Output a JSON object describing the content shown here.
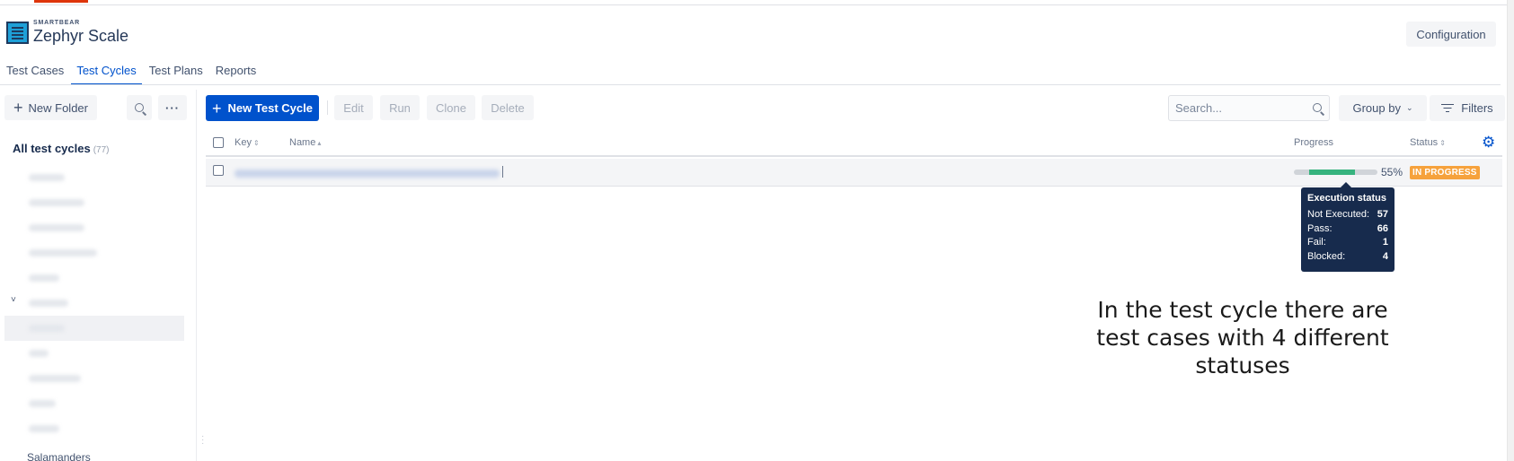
{
  "brand": {
    "vendor": "SMARTBEAR",
    "product": "Zephyr Scale"
  },
  "header": {
    "configuration_label": "Configuration"
  },
  "tabs": [
    {
      "label": "Test Cases",
      "active": false
    },
    {
      "label": "Test Cycles",
      "active": true
    },
    {
      "label": "Test Plans",
      "active": false
    },
    {
      "label": "Reports",
      "active": false
    }
  ],
  "sidebar": {
    "new_folder_label": "New Folder",
    "more_label": "···",
    "all_cycles_label": "All test cycles",
    "all_cycles_count": "(77)",
    "partial_folder_label": "Salamanders"
  },
  "toolbar": {
    "new_cycle_label": "New Test Cycle",
    "edit_label": "Edit",
    "run_label": "Run",
    "clone_label": "Clone",
    "delete_label": "Delete",
    "search_placeholder": "Search...",
    "group_by_label": "Group by",
    "filters_label": "Filters"
  },
  "table": {
    "columns": {
      "key": "Key",
      "name": "Name",
      "progress": "Progress",
      "status": "Status"
    },
    "rows": [
      {
        "progress_fraction": 0.55,
        "progress_label": "55%",
        "status": "IN PROGRESS"
      }
    ]
  },
  "tooltip": {
    "title": "Execution status",
    "items": [
      {
        "label": "Not Executed:",
        "value": "57"
      },
      {
        "label": "Pass:",
        "value": "66"
      },
      {
        "label": "Fail:",
        "value": "1"
      },
      {
        "label": "Blocked:",
        "value": "4"
      }
    ]
  },
  "annotation": {
    "line1": "In the test cycle there are",
    "line2": "test cases with 4 different",
    "line3": "statuses"
  },
  "colors": {
    "primary": "#0052cc",
    "progress_fill": "#36b37e",
    "status_in_progress": "#f6a23c",
    "tooltip_bg": "#172b4d"
  }
}
